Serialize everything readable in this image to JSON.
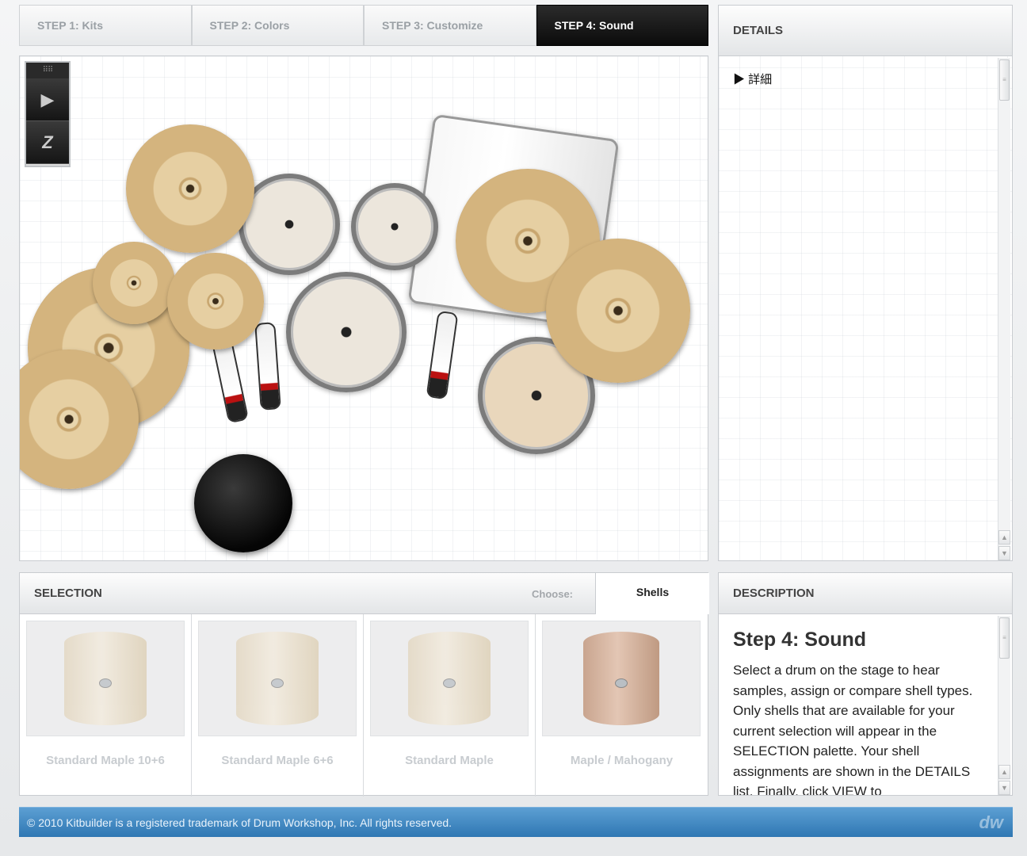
{
  "tabs": [
    {
      "label": "STEP 1: Kits",
      "active": false
    },
    {
      "label": "STEP 2: Colors",
      "active": false
    },
    {
      "label": "STEP 3: Customize",
      "active": false
    },
    {
      "label": "STEP 4: Sound",
      "active": true
    }
  ],
  "toolbar": {
    "grip_glyph": "⠿⠿",
    "play_glyph": "▶",
    "reset_glyph": "Z"
  },
  "details": {
    "title": "DETAILS",
    "toggle_label": "▶ 詳細"
  },
  "selection": {
    "title": "SELECTION",
    "choose_label": "Choose:",
    "active_tab": "Shells",
    "shells": [
      {
        "label": "Standard Maple 10+6",
        "finish": "maple"
      },
      {
        "label": "Standard Maple 6+6",
        "finish": "maple"
      },
      {
        "label": "Standard Maple",
        "finish": "maple"
      },
      {
        "label": "Maple / Mahogany",
        "finish": "mahogany"
      }
    ]
  },
  "description": {
    "title": "DESCRIPTION",
    "heading": "Step 4: Sound",
    "body": "Select a drum on the stage to hear samples, assign or compare shell types. Only shells that are available for your current selection will appear in the SELECTION palette. Your shell assignments are shown in the DETAILS list. Finally, click VIEW to"
  },
  "footer": {
    "copyright": "© 2010 Kitbuilder is a registered trademark of Drum Workshop, Inc. All rights reserved.",
    "logo_text": "dw"
  },
  "colors": {
    "active_tab": "#111111",
    "footer_blue": "#3a82bd"
  }
}
